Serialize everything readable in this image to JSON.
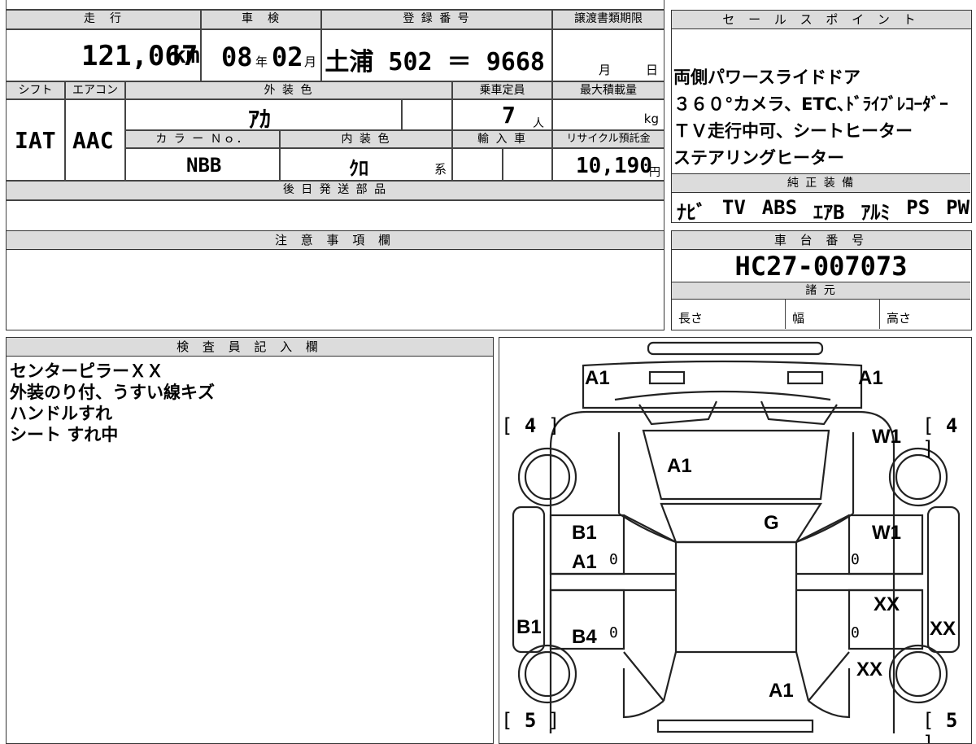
{
  "vehicle": {
    "headers": {
      "mileage": "走　行",
      "inspection": "車　検",
      "registration": "登 録 番 号",
      "transfer_deadline": "譲渡書類期限",
      "shift": "シフト",
      "ac": "エアコン",
      "exterior_color": "外 装 色",
      "capacity": "乗車定員",
      "max_load": "最大積載量",
      "color_no": "カ ラ ー Ｎｏ．",
      "interior_color": "内 装 色",
      "import": "輸 入 車",
      "recycle": "リサイクル預託金",
      "later_parts": "後 日 発 送 部 品"
    },
    "mileage": "121,067",
    "mileage_unit": "km",
    "inspection_year": "08",
    "inspection_year_unit": "年",
    "inspection_month": "02",
    "inspection_month_unit": "月",
    "registration": "土浦 502 ＝ 9668",
    "deadline_month_unit": "月",
    "deadline_day_unit": "日",
    "shift": "IAT",
    "ac": "AAC",
    "exterior_color": "ｱｶ",
    "capacity": "7",
    "capacity_unit": "人",
    "max_load_unit": "kg",
    "color_no": "NBB",
    "interior_color": "ｸﾛ",
    "interior_suffix": "系",
    "recycle_fee": "10,190",
    "recycle_unit": "円"
  },
  "sales_points": {
    "header": "セ ー ル ス ポ イ ン ト",
    "lines": [
      "両側パワースライドドア",
      "３６０°カメラ、ETC､ﾄﾞﾗｲﾌﾞﾚｺｰﾀﾞｰ",
      "ＴＶ走行中可、シートヒーター",
      "ステアリングヒーター"
    ]
  },
  "standard_equipment": {
    "header": "純 正 装 備",
    "items": [
      "ﾅﾋﾞ",
      "TV",
      "ABS",
      "ｴｱB",
      "ｱﾙﾐ",
      "PS",
      "PW"
    ]
  },
  "notes": {
    "header": "注 意 事 項 欄"
  },
  "chassis": {
    "header": "車 台 番 号",
    "number": "HC27-007073"
  },
  "specs": {
    "header": "諸 元",
    "length": "長さ",
    "width": "幅",
    "height": "高さ"
  },
  "inspector": {
    "header": "検 査 員 記 入 欄",
    "lines": [
      "センターピラーＸＸ",
      "外装のり付、うすい線キズ",
      "ハンドルすれ",
      "シート すれ中"
    ]
  },
  "diagram": {
    "marks": {
      "front_left": "A1",
      "front_right": "A1",
      "hood": "A1",
      "roof": "G",
      "fender_right": "W1",
      "front_door_right": "W1",
      "front_door_left_top": "B1",
      "front_door_left_bottom": "A1",
      "rocker_left": "B1",
      "rear_door_left": "B4",
      "rear_door_right": "XX",
      "rocker_right": "XX",
      "rear_fender_right": "XX",
      "rear": "A1"
    },
    "tire_front_left": "4",
    "tire_front_right": "4",
    "tire_rear_left": "5",
    "tire_rear_right": "5",
    "zero": "0",
    "bracket_open": "[",
    "bracket_close": "]"
  }
}
